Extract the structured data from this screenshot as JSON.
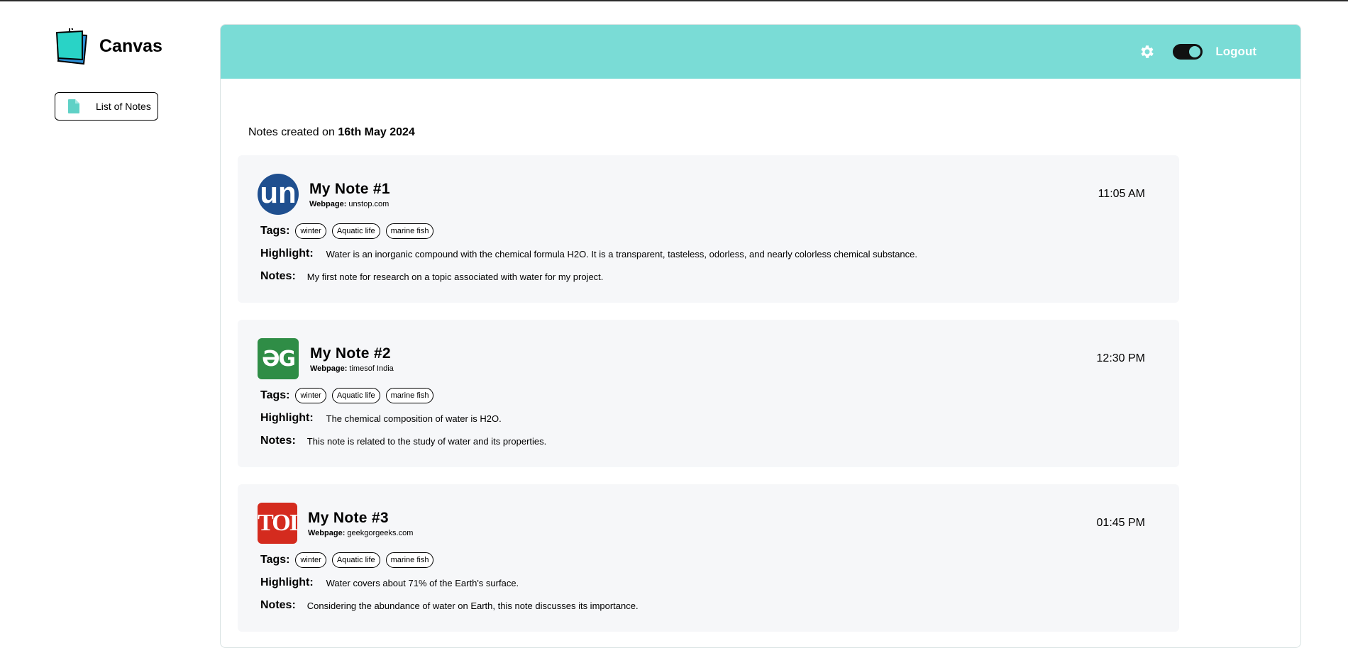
{
  "app": {
    "name": "Canvas"
  },
  "sidebar": {
    "items": [
      {
        "label": "List of Notes",
        "icon": "document-icon"
      }
    ]
  },
  "header": {
    "logout_label": "Logout",
    "settings_icon": "gear-icon",
    "theme_toggle_on": true
  },
  "main": {
    "date_prefix": "Notes created on",
    "date": "16th May 2024",
    "notes": [
      {
        "title": "My Note #1",
        "webpage_label": "Webpage:",
        "webpage": "unstop.com",
        "time": "11:05 AM",
        "avatar_text": "un",
        "avatar_color": "#1f4f8f",
        "tags_label": "Tags:",
        "tags": [
          "winter",
          "Aquatic life",
          "marine fish"
        ],
        "highlight_label": "Highlight:",
        "highlight": "Water is an inorganic compound with the chemical formula H2O. It is a transparent, tasteless, odorless, and nearly colorless chemical substance.",
        "notes_label": "Notes:",
        "notes": "My first note for research on a topic associated with water for my project."
      },
      {
        "title": "My Note #2",
        "webpage_label": "Webpage:",
        "webpage": "timesof India",
        "time": "12:30 PM",
        "avatar_text": "ƏG",
        "avatar_color": "#2f8d46",
        "tags_label": "Tags:",
        "tags": [
          "winter",
          "Aquatic life",
          "marine fish"
        ],
        "highlight_label": "Highlight:",
        "highlight": "The chemical composition of water is H2O.",
        "notes_label": "Notes:",
        "notes": "This note is related to the study of water and its properties."
      },
      {
        "title": "My Note #3",
        "webpage_label": "Webpage:",
        "webpage": "geekgorgeeks.com",
        "time": "01:45 PM",
        "avatar_text": "TOI",
        "avatar_color": "#d42b1e",
        "tags_label": "Tags:",
        "tags": [
          "winter",
          "Aquatic life",
          "marine fish"
        ],
        "highlight_label": "Highlight:",
        "highlight": "Water covers about 71% of the Earth's surface.",
        "notes_label": "Notes:",
        "notes": "Considering the abundance of water on Earth, this note discusses its importance."
      }
    ]
  },
  "colors": {
    "accent": "#7adcd6",
    "card_bg": "#f6f7f9"
  }
}
